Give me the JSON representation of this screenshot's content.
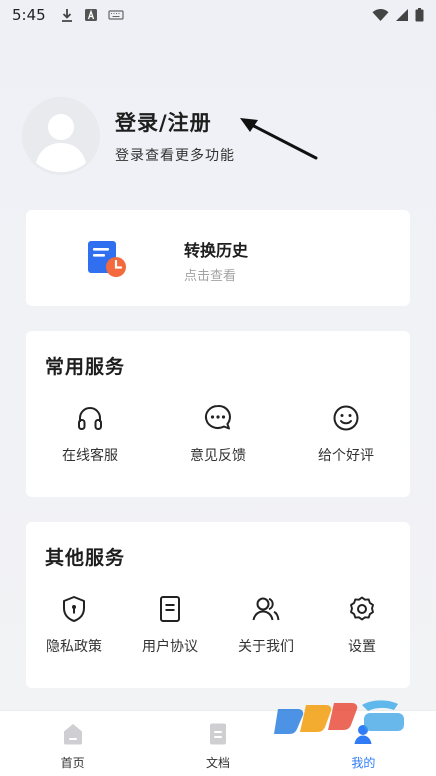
{
  "status_bar": {
    "time": "5:45",
    "left_icons": [
      "download-icon",
      "a-box-icon",
      "keyboard-icon"
    ],
    "right_icons": [
      "wifi-icon",
      "signal-icon",
      "battery-icon"
    ]
  },
  "profile": {
    "title": "登录/注册",
    "subtitle": "登录查看更多功能"
  },
  "history": {
    "title": "转换历史",
    "subtitle": "点击查看"
  },
  "common_services": {
    "title": "常用服务",
    "items": [
      {
        "label": "在线客服",
        "icon": "headphones-icon"
      },
      {
        "label": "意见反馈",
        "icon": "chat-bubble-icon"
      },
      {
        "label": "给个好评",
        "icon": "smiley-icon"
      }
    ]
  },
  "other_services": {
    "title": "其他服务",
    "items": [
      {
        "label": "隐私政策",
        "icon": "shield-icon"
      },
      {
        "label": "用户协议",
        "icon": "document-icon"
      },
      {
        "label": "关于我们",
        "icon": "users-icon"
      },
      {
        "label": "设置",
        "icon": "gear-icon"
      }
    ]
  },
  "tabbar": {
    "tabs": [
      {
        "label": "首页",
        "icon": "home-icon"
      },
      {
        "label": "文档",
        "icon": "file-icon"
      },
      {
        "label": "我的",
        "icon": "person-icon",
        "active": true
      }
    ]
  },
  "colors": {
    "accent": "#2f7cf6",
    "history_icon_blue": "#2f6ff0",
    "history_icon_orange": "#f26a3d"
  }
}
